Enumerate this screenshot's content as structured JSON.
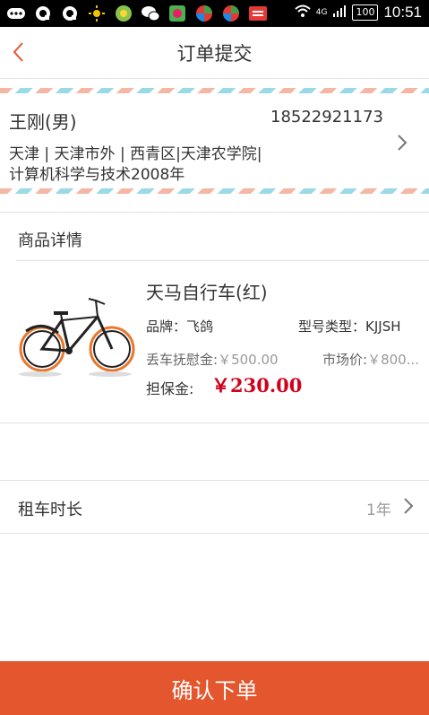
{
  "status_bar": {
    "time": "10:51",
    "battery": "100",
    "network": "4G",
    "icons": [
      "more-icon",
      "chat-icon",
      "chat-icon",
      "sun-icon",
      "app-icon",
      "wechat-icon",
      "app-icon",
      "app-icon",
      "app-icon",
      "news-icon",
      "wifi-icon",
      "signal-icon",
      "battery-icon"
    ]
  },
  "header": {
    "title": "订单提交",
    "back_icon": "chevron-left-icon"
  },
  "address": {
    "name": "王刚(男)",
    "phone": "18522921173",
    "line1": "天津 | 天津市外 | 西青区|天津农学院|",
    "line2": "计算机科学与技术2008年"
  },
  "goods": {
    "section_title": "商品详情",
    "name": "天马自行车(红)",
    "brand_label": "品牌：",
    "brand_value": "飞鸽",
    "model_label": "型号类型：",
    "model_value": "KJJSH",
    "loss_label": "丢车抚慰金:",
    "loss_value": "￥500.00",
    "market_label": "市场价:",
    "market_value": "￥800...",
    "deposit_label": "担保金:",
    "deposit_value": "￥230.00"
  },
  "duration": {
    "label": "租车时长",
    "value": "1年"
  },
  "submit_label": "确认下单",
  "colors": {
    "accent": "#e4572e",
    "back_arrow": "#e4572e",
    "price": "#d0021b",
    "airmail_red": "#f4b7a4",
    "airmail_blue": "#9ad9e6"
  }
}
